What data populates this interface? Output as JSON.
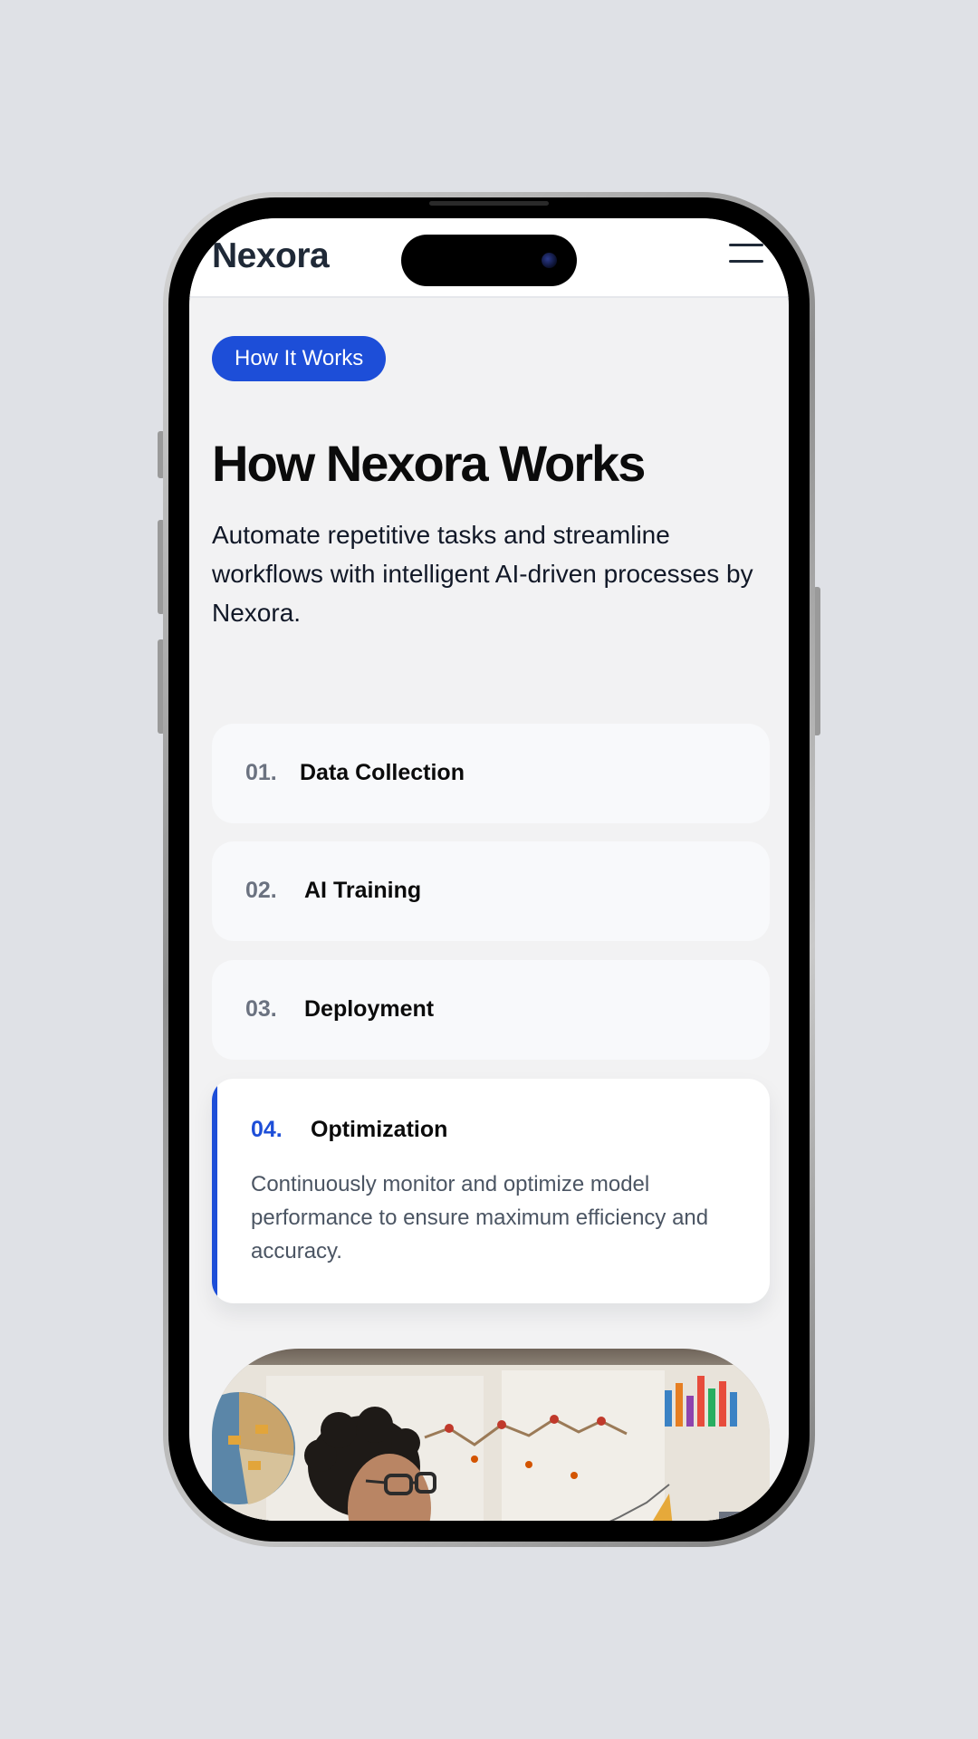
{
  "app": {
    "logo": "Nexora",
    "menu_icon": "hamburger-icon"
  },
  "section": {
    "badge": "How It Works",
    "title": "How Nexora Works",
    "subtitle": "Automate repetitive tasks and streamline workflows with intelligent AI-driven processes by Nexora."
  },
  "steps": [
    {
      "num": "01.",
      "title": "Data Collection",
      "expanded": false
    },
    {
      "num": "02.",
      "title": "AI Training",
      "expanded": false
    },
    {
      "num": "03.",
      "title": "Deployment",
      "expanded": false
    },
    {
      "num": "04.",
      "title": "Optimization",
      "expanded": true,
      "description": "Continuously monitor and optimize model performance to ensure maximum efficiency and accuracy."
    }
  ],
  "colors": {
    "accent": "#1d4ed8",
    "page_bg": "#f2f2f3",
    "card_bg": "#f8f9fb",
    "muted_text": "#6b7280"
  }
}
